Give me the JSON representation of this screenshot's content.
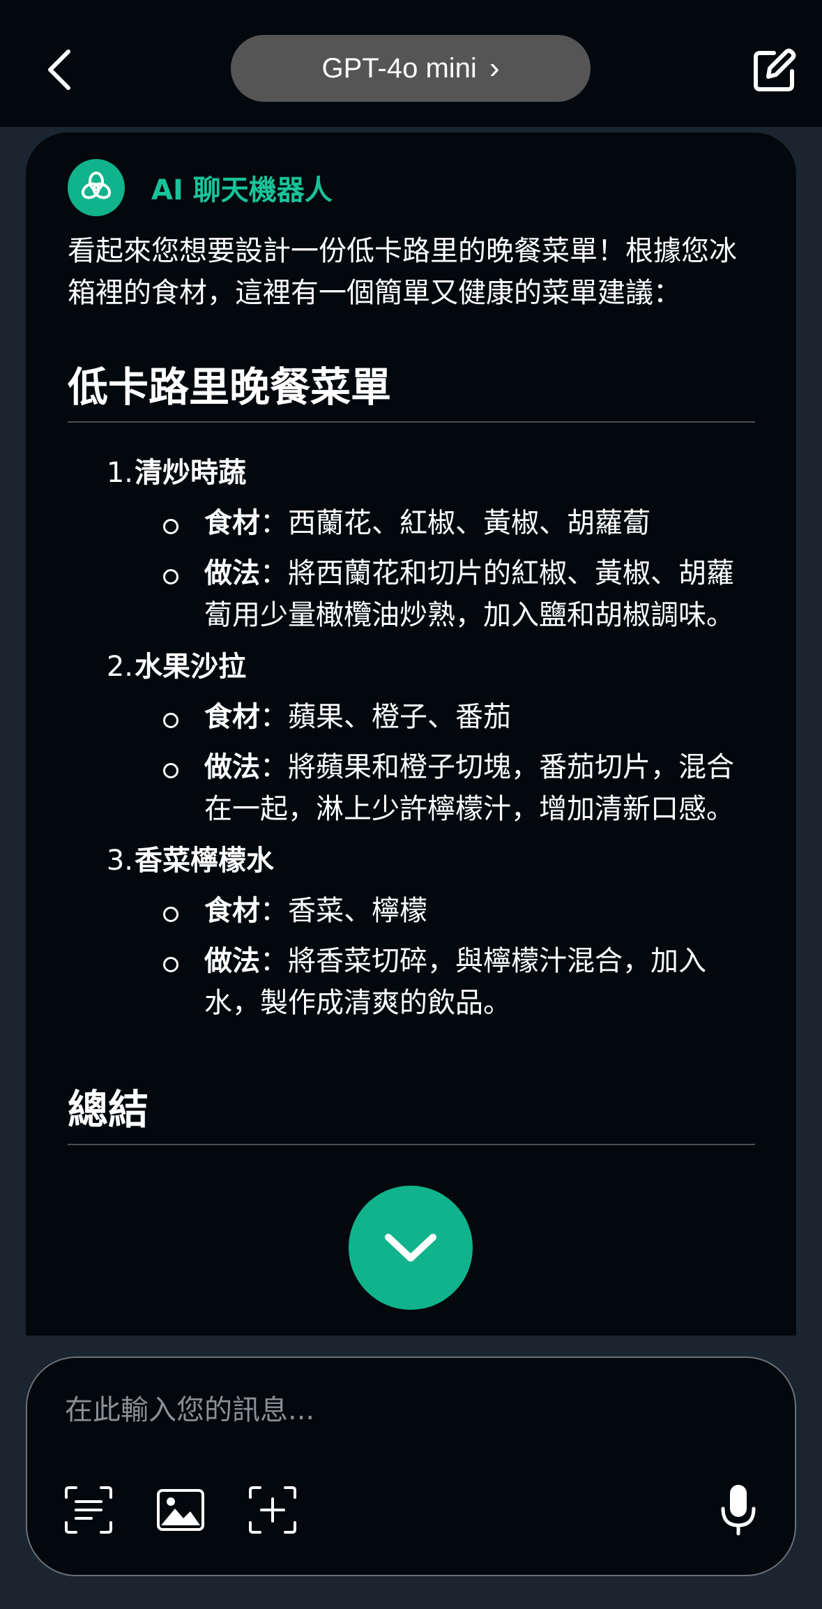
{
  "header": {
    "model_name": "GPT-4o mini",
    "model_chevron": "›"
  },
  "bot": {
    "name": "AI 聊天機器人"
  },
  "message": {
    "intro": "看起來您想要設計一份低卡路里的晚餐菜單！根據您冰箱裡的食材，這裡有一個簡單又健康的菜單建議：",
    "heading": "低卡路里晚餐菜單",
    "items": [
      {
        "num": "1.",
        "title": "清炒時蔬",
        "ingredients_key": "食材",
        "ingredients": "：西蘭花、紅椒、黃椒、胡蘿蔔",
        "method_key": "做法",
        "method": "：將西蘭花和切片的紅椒、黃椒、胡蘿蔔用少量橄欖油炒熟，加入鹽和胡椒調味。"
      },
      {
        "num": "2.",
        "title": "水果沙拉",
        "ingredients_key": "食材",
        "ingredients": "：蘋果、橙子、番茄",
        "method_key": "做法",
        "method": "：將蘋果和橙子切塊，番茄切片，混合在一起，淋上少許檸檬汁，增加清新口感。"
      },
      {
        "num": "3.",
        "title": "香菜檸檬水",
        "ingredients_key": "食材",
        "ingredients": "：香菜、檸檬",
        "method_key": "做法",
        "method": "：將香菜切碎，與檸檬汁混合，加入水，製作成清爽的飲品。"
      }
    ],
    "summary_heading": "總結"
  },
  "input": {
    "placeholder": "在此輸入您的訊息..."
  },
  "colors": {
    "accent": "#10b38c",
    "accent_text": "#19c39a",
    "background": "#1b2530",
    "surface": "#03080d",
    "pill": "#555555"
  },
  "icons": {
    "back": "back-arrow-icon",
    "edit": "edit-icon",
    "bot_avatar": "openai-logo-icon",
    "scroll_down": "chevron-down-icon",
    "scan_text": "scan-text-icon",
    "image": "image-icon",
    "add": "add-frame-icon",
    "mic": "microphone-icon"
  }
}
